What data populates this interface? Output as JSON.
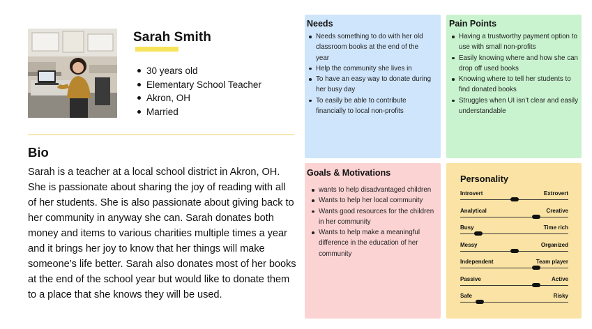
{
  "persona": {
    "name": "Sarah Smith",
    "facts": [
      "30 years old",
      "Elementary School Teacher",
      "Akron, OH",
      "Married"
    ]
  },
  "bio": {
    "heading": "Bio",
    "text": "Sarah is a teacher at a local school district in Akron, OH. She is passionate about sharing the joy of reading with all of her students. She is also passionate about giving back to her community in anyway she can. Sarah donates both money and items to various charities multiple times a year and it brings her joy to know that her things will make someone’s life better. Sarah also donates most of her books at the end of the school year but would like to donate them to a place that she knows they will be used."
  },
  "needs": {
    "title": "Needs",
    "items": [
      "Needs something to do with her old classroom books at the end of the year",
      "Help the community she lives in",
      "To have an easy way to donate during her busy day",
      "To easily be able to contribute financially to local non-profits"
    ]
  },
  "pain_points": {
    "title": "Pain Points",
    "items": [
      "Having a trustworthy payment option to use with small non-profits",
      "Easily knowing where and how she can drop off used books",
      "Knowing where to tell her students to find donated books",
      "Struggles when UI isn’t clear and easily understandable"
    ]
  },
  "goals": {
    "title": "Goals & Motivations",
    "items": [
      "wants to help disadvantaged children",
      "Wants to help her local community",
      "Wants good resources for the children in her community",
      "Wants to help make a meaningful difference in the education of her community"
    ]
  },
  "personality": {
    "title": "Personality",
    "traits": [
      {
        "left": "Introvert",
        "right": "Extrovert",
        "value": 0.5
      },
      {
        "left": "Analytical",
        "right": "Creative",
        "value": 0.7
      },
      {
        "left": "Busy",
        "right": "Time rich",
        "value": 0.17
      },
      {
        "left": "Messy",
        "right": "Organized",
        "value": 0.5
      },
      {
        "left": "Independent",
        "right": "Team player",
        "value": 0.7
      },
      {
        "left": "Passive",
        "right": "Active",
        "value": 0.7
      },
      {
        "left": "Safe",
        "right": "Risky",
        "value": 0.18
      }
    ]
  },
  "colors": {
    "needs_bg": "#cfe5fb",
    "pain_points_bg": "#c9f3cf",
    "goals_bg": "#fbd3d3",
    "personality_bg": "#fae3a4",
    "name_highlight": "#f6e35a"
  }
}
